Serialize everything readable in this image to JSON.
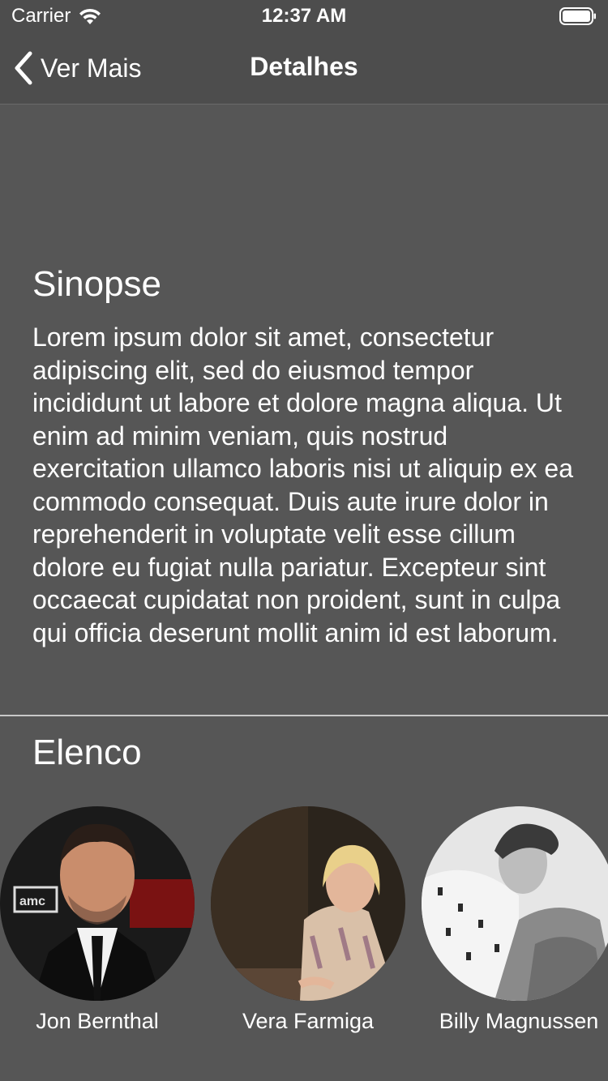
{
  "status_bar": {
    "carrier": "Carrier",
    "time": "12:37 AM"
  },
  "nav": {
    "back_label": "Ver Mais",
    "title": "Detalhes"
  },
  "synopsis": {
    "title": "Sinopse",
    "text": "Lorem ipsum dolor sit amet, consectetur adipiscing elit, sed do eiusmod tempor incididunt ut labore et dolore magna aliqua. Ut enim ad minim veniam, quis nostrud exercitation ullamco laboris nisi ut aliquip ex ea commodo consequat. Duis aute irure dolor in reprehenderit in voluptate velit esse cillum dolore eu fugiat nulla pariatur. Excepteur sint occaecat cupidatat non proident, sunt in culpa qui officia deserunt mollit anim id est laborum."
  },
  "cast": {
    "title": "Elenco",
    "members": [
      {
        "name": "Jon Bernthal",
        "photo_logo_text": "amc"
      },
      {
        "name": "Vera Farmiga"
      },
      {
        "name": "Billy Magnussen"
      }
    ]
  },
  "colors": {
    "background": "#565656",
    "bar": "#4d4d4d",
    "text": "#ffffff",
    "divider": "#c8c8c8"
  }
}
